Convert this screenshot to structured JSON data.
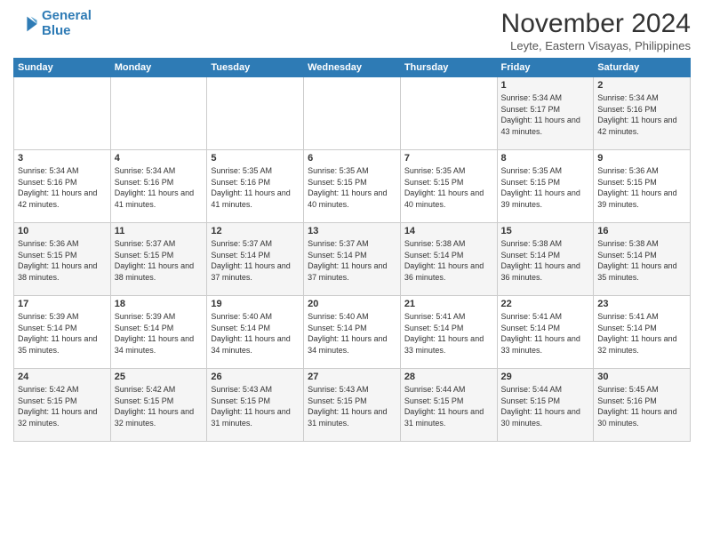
{
  "logo": {
    "line1": "General",
    "line2": "Blue"
  },
  "title": "November 2024",
  "subtitle": "Leyte, Eastern Visayas, Philippines",
  "headers": [
    "Sunday",
    "Monday",
    "Tuesday",
    "Wednesday",
    "Thursday",
    "Friday",
    "Saturday"
  ],
  "weeks": [
    [
      {
        "day": "",
        "info": ""
      },
      {
        "day": "",
        "info": ""
      },
      {
        "day": "",
        "info": ""
      },
      {
        "day": "",
        "info": ""
      },
      {
        "day": "",
        "info": ""
      },
      {
        "day": "1",
        "info": "Sunrise: 5:34 AM\nSunset: 5:17 PM\nDaylight: 11 hours and 43 minutes."
      },
      {
        "day": "2",
        "info": "Sunrise: 5:34 AM\nSunset: 5:16 PM\nDaylight: 11 hours and 42 minutes."
      }
    ],
    [
      {
        "day": "3",
        "info": "Sunrise: 5:34 AM\nSunset: 5:16 PM\nDaylight: 11 hours and 42 minutes."
      },
      {
        "day": "4",
        "info": "Sunrise: 5:34 AM\nSunset: 5:16 PM\nDaylight: 11 hours and 41 minutes."
      },
      {
        "day": "5",
        "info": "Sunrise: 5:35 AM\nSunset: 5:16 PM\nDaylight: 11 hours and 41 minutes."
      },
      {
        "day": "6",
        "info": "Sunrise: 5:35 AM\nSunset: 5:15 PM\nDaylight: 11 hours and 40 minutes."
      },
      {
        "day": "7",
        "info": "Sunrise: 5:35 AM\nSunset: 5:15 PM\nDaylight: 11 hours and 40 minutes."
      },
      {
        "day": "8",
        "info": "Sunrise: 5:35 AM\nSunset: 5:15 PM\nDaylight: 11 hours and 39 minutes."
      },
      {
        "day": "9",
        "info": "Sunrise: 5:36 AM\nSunset: 5:15 PM\nDaylight: 11 hours and 39 minutes."
      }
    ],
    [
      {
        "day": "10",
        "info": "Sunrise: 5:36 AM\nSunset: 5:15 PM\nDaylight: 11 hours and 38 minutes."
      },
      {
        "day": "11",
        "info": "Sunrise: 5:37 AM\nSunset: 5:15 PM\nDaylight: 11 hours and 38 minutes."
      },
      {
        "day": "12",
        "info": "Sunrise: 5:37 AM\nSunset: 5:14 PM\nDaylight: 11 hours and 37 minutes."
      },
      {
        "day": "13",
        "info": "Sunrise: 5:37 AM\nSunset: 5:14 PM\nDaylight: 11 hours and 37 minutes."
      },
      {
        "day": "14",
        "info": "Sunrise: 5:38 AM\nSunset: 5:14 PM\nDaylight: 11 hours and 36 minutes."
      },
      {
        "day": "15",
        "info": "Sunrise: 5:38 AM\nSunset: 5:14 PM\nDaylight: 11 hours and 36 minutes."
      },
      {
        "day": "16",
        "info": "Sunrise: 5:38 AM\nSunset: 5:14 PM\nDaylight: 11 hours and 35 minutes."
      }
    ],
    [
      {
        "day": "17",
        "info": "Sunrise: 5:39 AM\nSunset: 5:14 PM\nDaylight: 11 hours and 35 minutes."
      },
      {
        "day": "18",
        "info": "Sunrise: 5:39 AM\nSunset: 5:14 PM\nDaylight: 11 hours and 34 minutes."
      },
      {
        "day": "19",
        "info": "Sunrise: 5:40 AM\nSunset: 5:14 PM\nDaylight: 11 hours and 34 minutes."
      },
      {
        "day": "20",
        "info": "Sunrise: 5:40 AM\nSunset: 5:14 PM\nDaylight: 11 hours and 34 minutes."
      },
      {
        "day": "21",
        "info": "Sunrise: 5:41 AM\nSunset: 5:14 PM\nDaylight: 11 hours and 33 minutes."
      },
      {
        "day": "22",
        "info": "Sunrise: 5:41 AM\nSunset: 5:14 PM\nDaylight: 11 hours and 33 minutes."
      },
      {
        "day": "23",
        "info": "Sunrise: 5:41 AM\nSunset: 5:14 PM\nDaylight: 11 hours and 32 minutes."
      }
    ],
    [
      {
        "day": "24",
        "info": "Sunrise: 5:42 AM\nSunset: 5:15 PM\nDaylight: 11 hours and 32 minutes."
      },
      {
        "day": "25",
        "info": "Sunrise: 5:42 AM\nSunset: 5:15 PM\nDaylight: 11 hours and 32 minutes."
      },
      {
        "day": "26",
        "info": "Sunrise: 5:43 AM\nSunset: 5:15 PM\nDaylight: 11 hours and 31 minutes."
      },
      {
        "day": "27",
        "info": "Sunrise: 5:43 AM\nSunset: 5:15 PM\nDaylight: 11 hours and 31 minutes."
      },
      {
        "day": "28",
        "info": "Sunrise: 5:44 AM\nSunset: 5:15 PM\nDaylight: 11 hours and 31 minutes."
      },
      {
        "day": "29",
        "info": "Sunrise: 5:44 AM\nSunset: 5:15 PM\nDaylight: 11 hours and 30 minutes."
      },
      {
        "day": "30",
        "info": "Sunrise: 5:45 AM\nSunset: 5:16 PM\nDaylight: 11 hours and 30 minutes."
      }
    ]
  ]
}
